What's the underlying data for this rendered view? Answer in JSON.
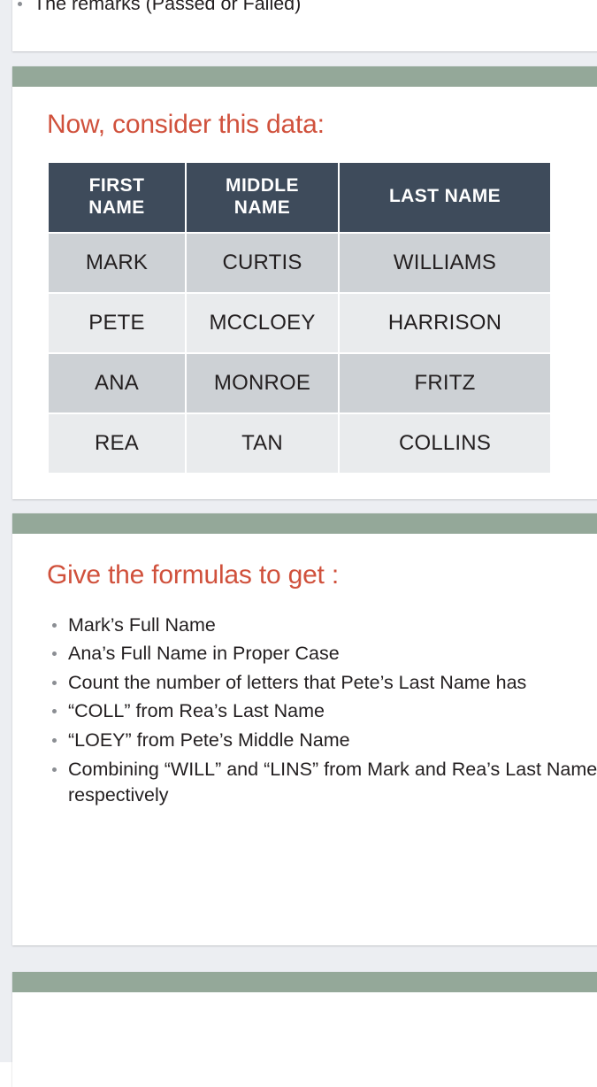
{
  "theme": {
    "page_background": "#eceef2",
    "card_background": "#ffffff",
    "accent_bar": "#94a899",
    "heading_color": "#d0513c",
    "table_header_bg": "#3e4b5b",
    "table_row_dark": "#cdd1d5",
    "table_row_light": "#e9ebed",
    "body_text": "#231f20"
  },
  "slide_top": {
    "partial_bullet": "The remarks (Passed or Failed)"
  },
  "slide_data": {
    "heading": "Now, consider this data:",
    "table": {
      "columns": [
        "FIRST NAME",
        "MIDDLE NAME",
        "LAST NAME"
      ],
      "columns_lines": [
        [
          "FIRST",
          "NAME"
        ],
        [
          "MIDDLE",
          "NAME"
        ],
        [
          "LAST NAME"
        ]
      ],
      "rows": [
        [
          "MARK",
          "CURTIS",
          "WILLIAMS"
        ],
        [
          "PETE",
          "MCCLOEY",
          "HARRISON"
        ],
        [
          "ANA",
          "MONROE",
          "FRITZ"
        ],
        [
          "REA",
          "TAN",
          "COLLINS"
        ]
      ]
    }
  },
  "slide_formulas": {
    "heading": "Give the formulas to get :",
    "bullets": [
      "Mark’s Full Name",
      "Ana’s Full Name in Proper Case",
      "Count the number of letters that Pete’s Last Name has",
      "“COLL” from Rea’s Last Name",
      "“LOEY” from Pete’s Middle Name",
      "Combining “WILL” and “LINS” from Mark and Rea’s Last Names respectively"
    ]
  }
}
